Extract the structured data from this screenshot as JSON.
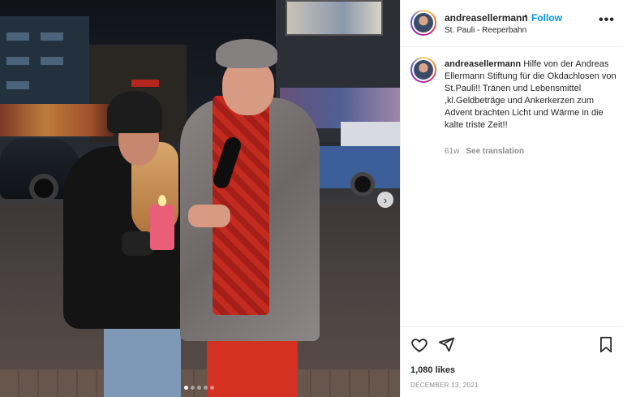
{
  "post": {
    "username": "andreasellermann",
    "separator": "•",
    "follow_label": "Follow",
    "location": "St. Pauli - Reeperbahn",
    "more_label": "•••",
    "caption_username": "andreasellermann",
    "caption_text": "Hilfe von der Andreas Ellermann Stiftung für die Okdachlosen von St.Pauli!! Tränen und Lebensmittel ,kl.Geldbeträge und Ankerkerzen zum Advent brachten Licht und Wärme in die kalte triste Zeit!!",
    "age": "61w",
    "see_translation_label": "See translation",
    "likes": "1,080 likes",
    "date": "DECEMBER 13, 2021"
  },
  "carousel": {
    "next_icon": "›",
    "dot_count": 5,
    "active_index": 0
  },
  "icons": {
    "like": "heart-outline-icon",
    "share": "paper-plane-icon",
    "save": "bookmark-outline-icon",
    "next": "chevron-right-icon",
    "more": "more-horizontal-icon"
  },
  "colors": {
    "link_blue": "#0095f6",
    "text": "#262626",
    "muted": "#8e8e8e",
    "border": "#efefef"
  }
}
